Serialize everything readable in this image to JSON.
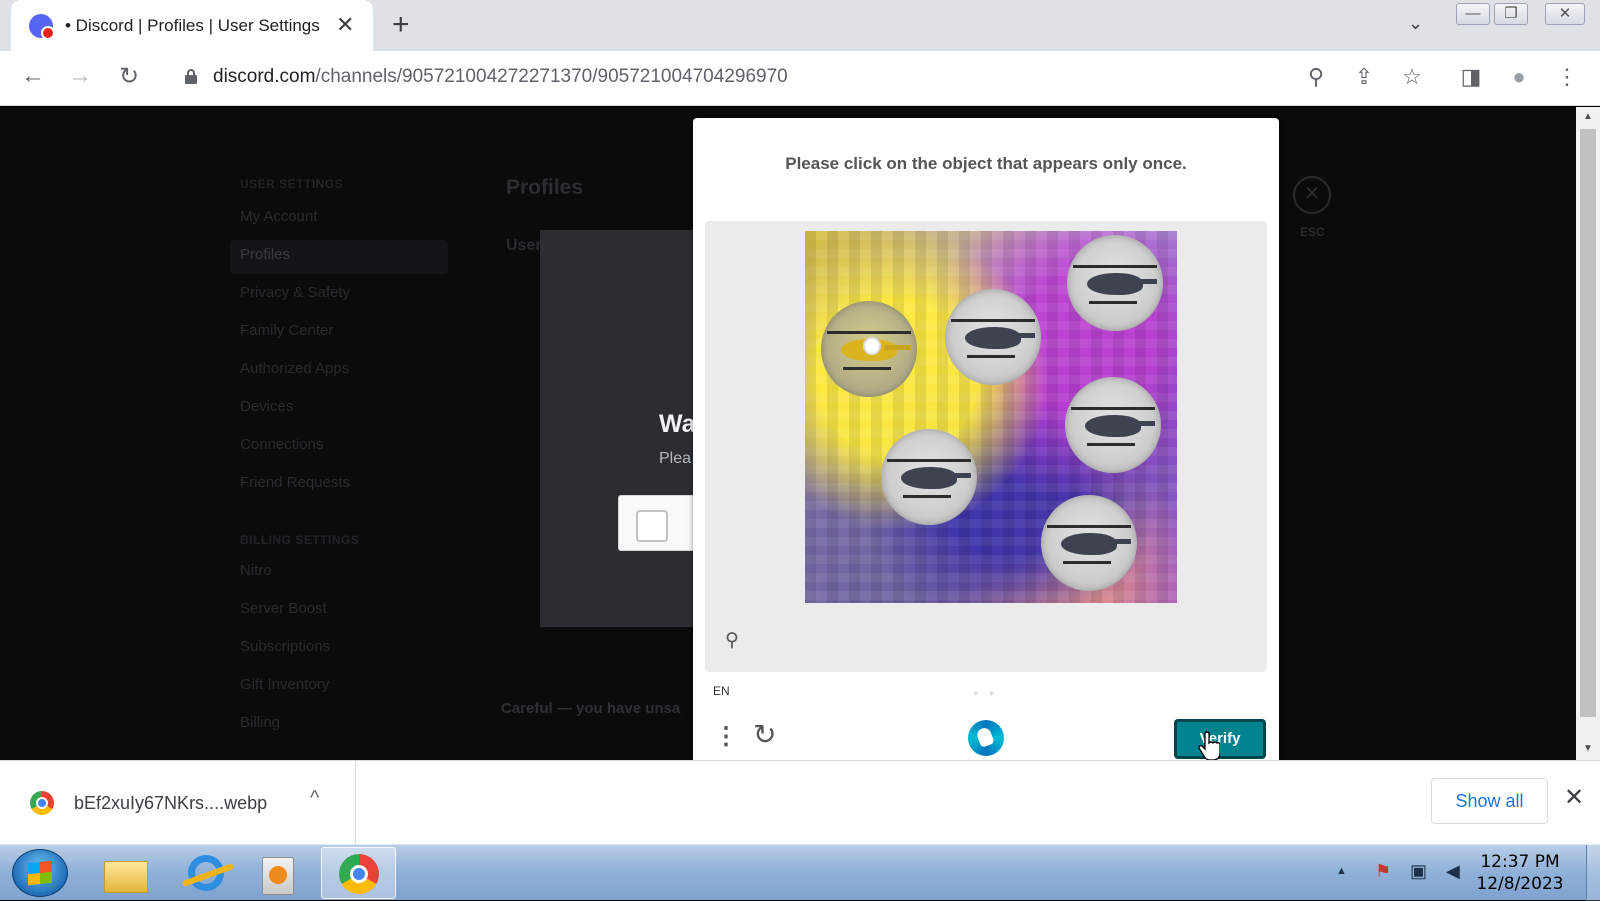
{
  "browser": {
    "tab_title": "• Discord | Profiles | User Settings",
    "tab_close": "✕",
    "new_tab": "+",
    "tab_search": "⌄",
    "window_minimize": "—",
    "window_restore": "❐",
    "window_close": "✕",
    "url_host": "discord.com",
    "url_path": "/channels/905721004272271370/905721004704296970",
    "nav": {
      "back": "←",
      "forward": "→",
      "reload": "↻"
    },
    "toolbar_icons": {
      "zoom": "⚲",
      "share": "⇪",
      "bookmark": "☆",
      "sidepanel": "◨",
      "profile": "●",
      "menu": "⋮"
    }
  },
  "discord": {
    "sidebar": {
      "user_settings_header": "USER SETTINGS",
      "items": [
        "My Account",
        "Profiles",
        "Privacy & Safety",
        "Family Center",
        "Authorized Apps",
        "Devices",
        "Connections",
        "Friend Requests"
      ],
      "billing_header": "BILLING SETTINGS",
      "billing_items": [
        "Nitro",
        "Server Boost",
        "Subscriptions",
        "Gift Inventory",
        "Billing"
      ]
    },
    "content_title": "Profiles",
    "tab_partial": "User",
    "modal_title_partial": "Wa",
    "modal_sub_partial": "Plea",
    "careful_text": "Careful — you have unsa",
    "esc_label": "ESC",
    "esc_symbol": "✕"
  },
  "captcha": {
    "prompt": "Please click on the object that appears only once.",
    "language": "EN",
    "pager": "● ●",
    "verify_label": "Verify",
    "menu_icon": "⋮",
    "refresh_icon": "↻",
    "zoom_icon": "⚲"
  },
  "downloads": {
    "file_name": "bEf2xuIy67NKrs....webp",
    "chevron": "^",
    "show_all_label": "Show all",
    "close": "✕"
  },
  "taskbar": {
    "time": "12:37 PM",
    "date": "12/8/2023",
    "tray_up": "▲",
    "tray_flag": "⚑",
    "tray_network": "▣",
    "tray_volume": "◀"
  }
}
